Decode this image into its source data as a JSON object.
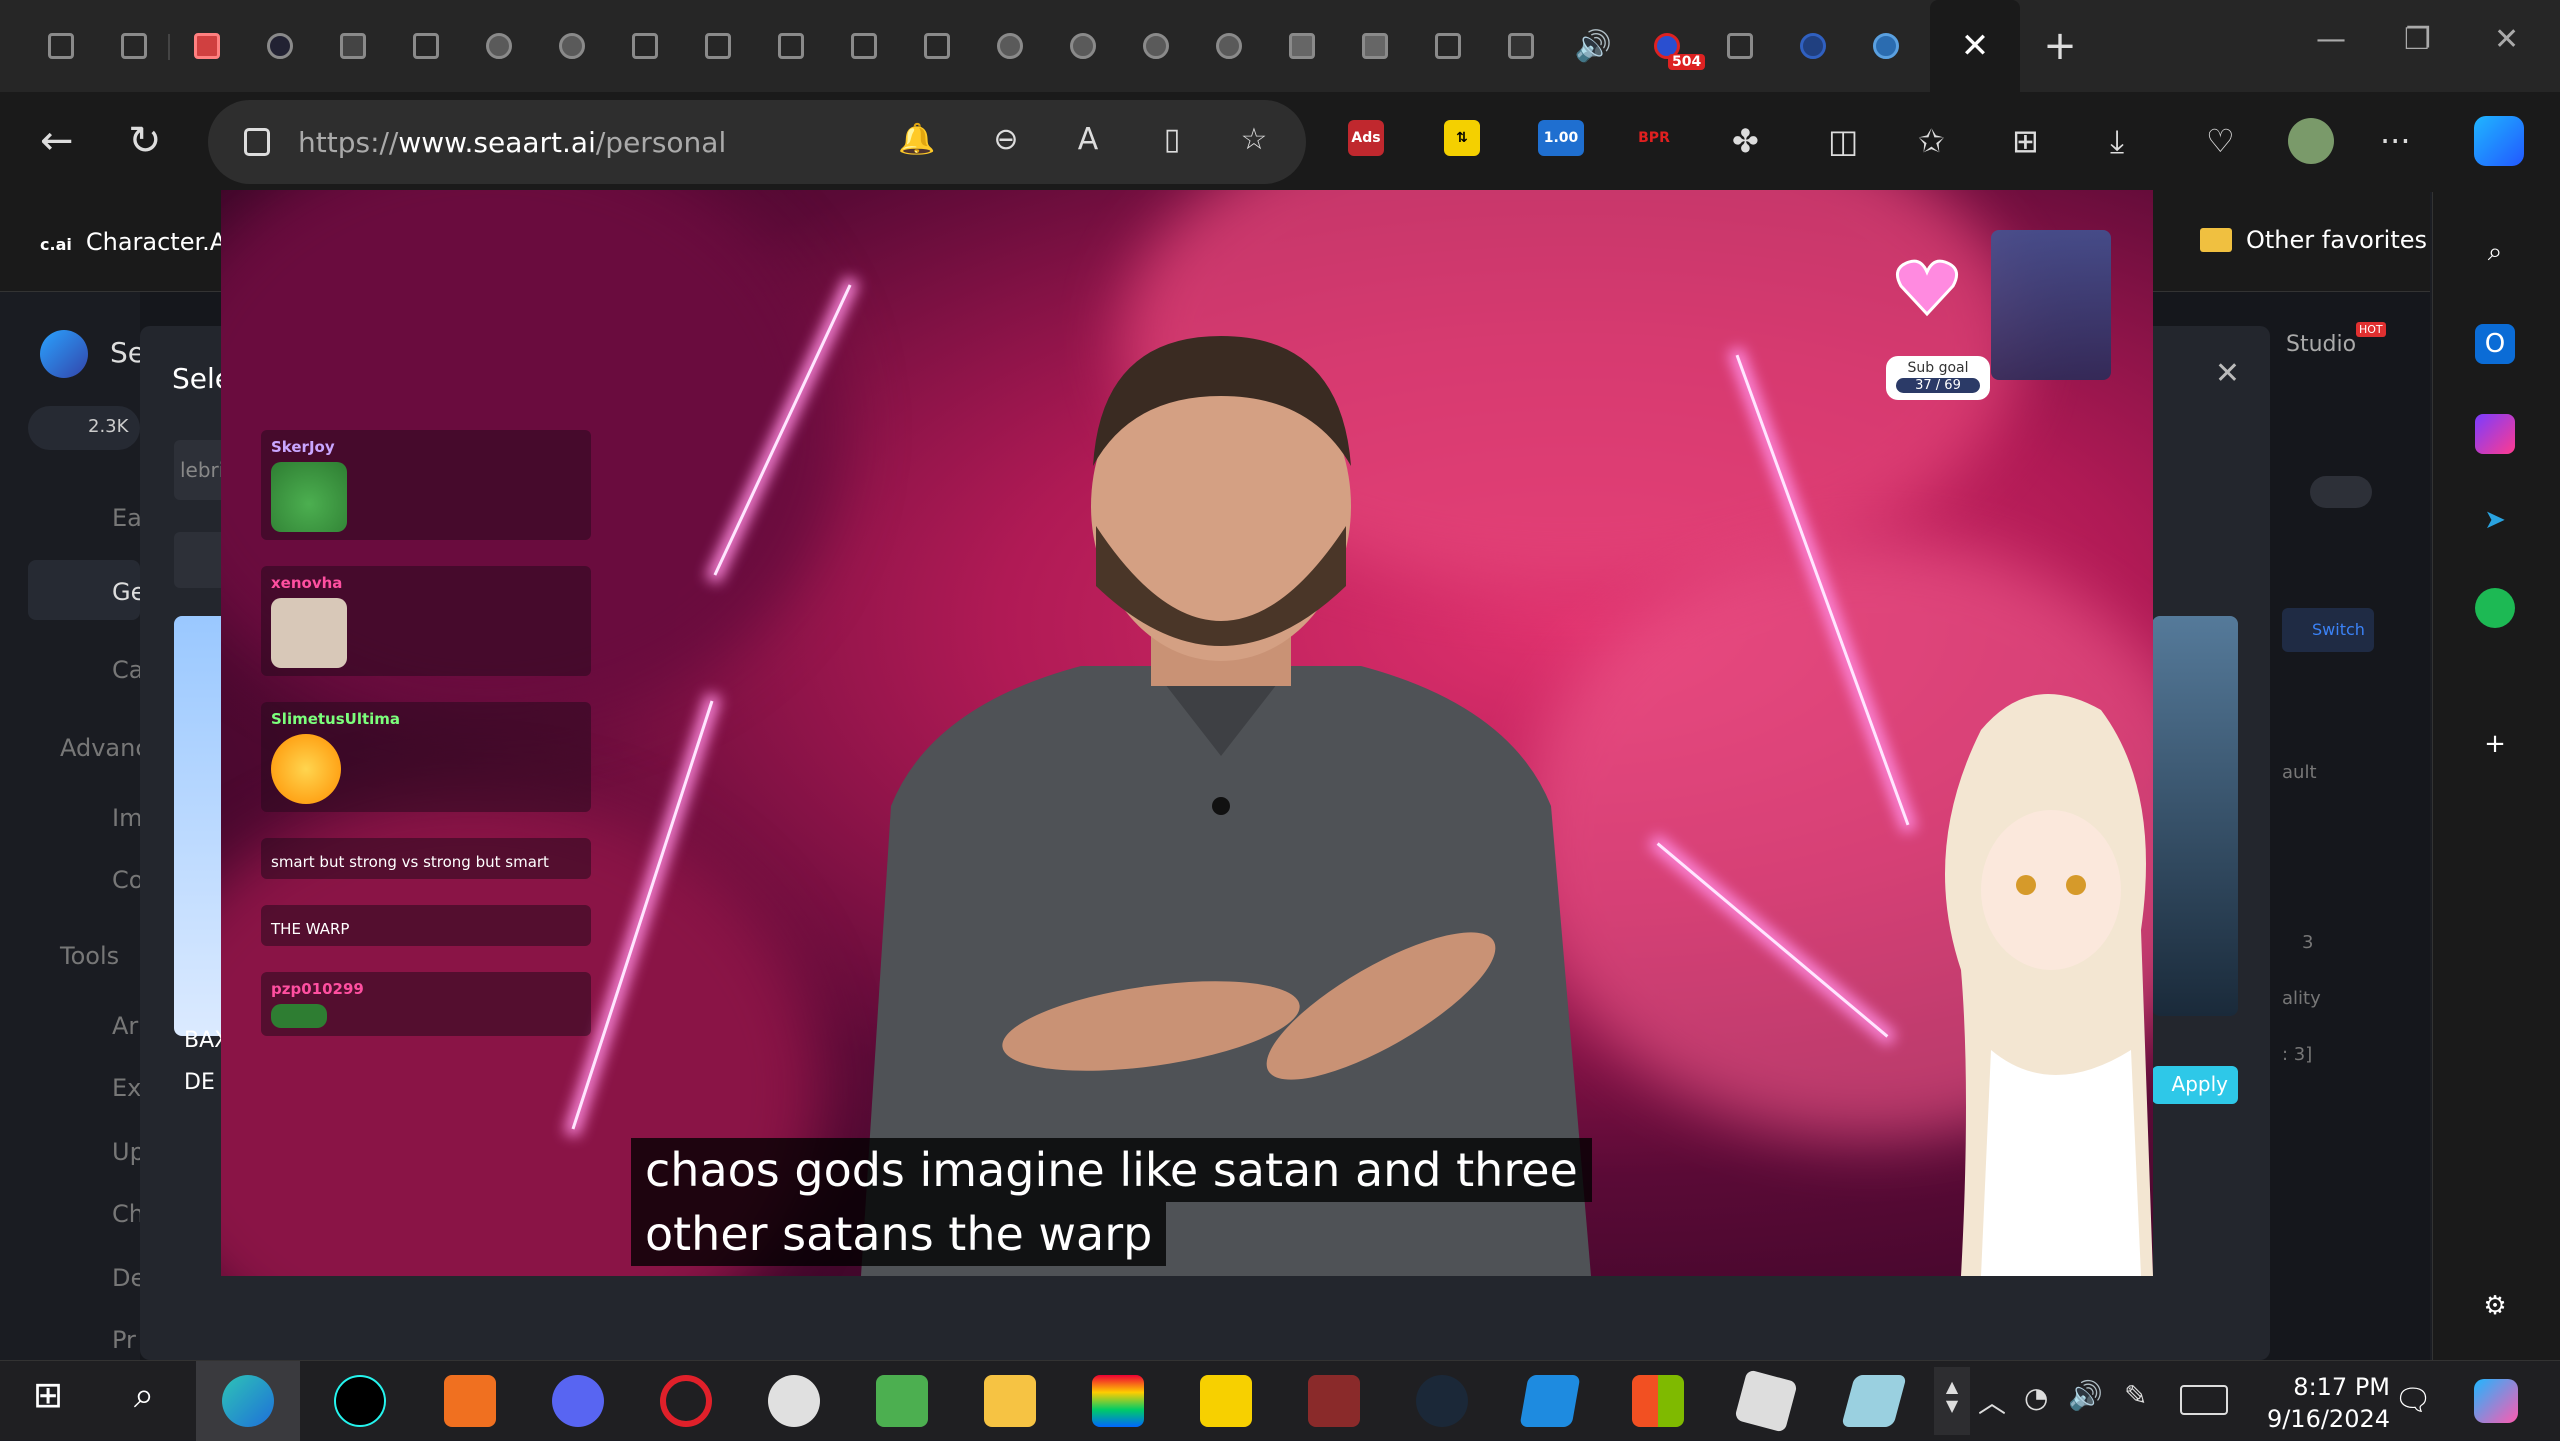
{
  "browser": {
    "url_prefix": "https://",
    "url_domain": "www.seaart.ai",
    "url_path": "/personal",
    "ext_ad_label": "Ads",
    "ext_counter": "1.00",
    "ext_bpr": "BPR",
    "tab_badge": "504",
    "close_tab": "✕",
    "new_tab": "+"
  },
  "favorites": {
    "character_ai_logo": "c.ai",
    "character_ai": "Character.AI",
    "other": "Other favorites"
  },
  "seaart": {
    "brand_partial": "Se",
    "credits": "2.3K",
    "modal_title_partial": "Sele",
    "nav": [
      "Ea",
      "Ge",
      "Ca",
      "Advanc",
      "Im",
      "Co",
      "Tools",
      "Ar",
      "Ex",
      "Up",
      "Ch",
      "De",
      "Pr"
    ],
    "studio": "Studio",
    "hot": "HOT",
    "switch": "Switch",
    "apply": "Apply",
    "tab_partial_left": "lebrit",
    "card_left_title": "BAX",
    "card_left_sub": "DE",
    "right_partials": [
      "ault",
      "3",
      "ality",
      ": 3]"
    ]
  },
  "video": {
    "caption_line1": "chaos gods imagine like satan and three",
    "caption_line2": "other satans the warp",
    "subgoal_label": "Sub goal",
    "subgoal_count": "37 / 69",
    "chat": [
      {
        "user": "SkerJoy",
        "color": "#c9a6ff",
        "text": ""
      },
      {
        "user": "xenovha",
        "color": "#ff4fa0",
        "text": ""
      },
      {
        "user": "SlimetusUltima",
        "color": "#7cff7c",
        "text": ""
      },
      {
        "user": "",
        "color": "#ff4444",
        "text": "smart but strong vs strong but smart"
      },
      {
        "user": "",
        "color": "#aaaaaa",
        "text": "THE WARP"
      },
      {
        "user": "pzp010299",
        "color": "#ff4fa0",
        "text": ""
      }
    ]
  },
  "taskbar": {
    "time": "8:17 PM",
    "date": "9/16/2024"
  }
}
